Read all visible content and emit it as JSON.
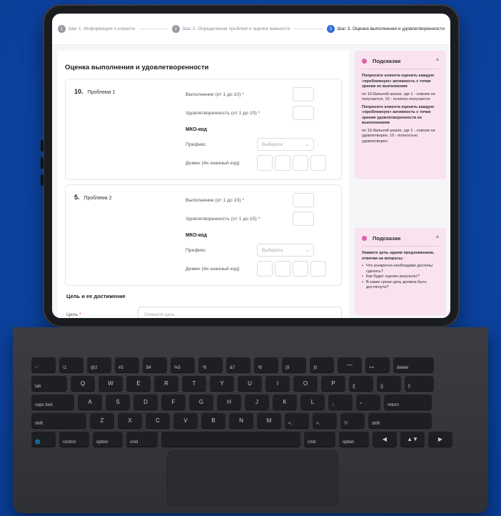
{
  "stepper": {
    "steps": [
      {
        "num": "1",
        "label": "Шаг 1. Информация о клиенте"
      },
      {
        "num": "2",
        "label": "Шаг 2. Определение проблем и оценка важности"
      },
      {
        "num": "3",
        "label": "Шаг 3. Оценка выполнения и удовлетворенности"
      }
    ]
  },
  "main": {
    "title": "Оценка выполнения и удовлетворенности",
    "problems": [
      {
        "num": "10.",
        "name": "Проблема 1",
        "perf_label": "Выполнение (от 1 до 10)",
        "sat_label": "Удовлетворенность (от 1 до 10)",
        "required_mark": "*",
        "mko_label": "МКО-код",
        "prefix_label": "Префикс",
        "prefix_placeholder": "Выберите",
        "domain_label": "Домен (4х-значный код)"
      },
      {
        "num": "5.",
        "name": "Проблема 2",
        "perf_label": "Выполнение (от 1 до 10)",
        "sat_label": "Удовлетворенность (от 1 до 10)",
        "required_mark": "*",
        "mko_label": "МКО-код",
        "prefix_label": "Префикс",
        "prefix_placeholder": "Выберите",
        "domain_label": "Домен (4х-значный код)"
      }
    ],
    "goal": {
      "title": "Цель и ее достижение",
      "label": "Цель",
      "required_mark": "*",
      "placeholder": "Опишите цель"
    }
  },
  "hints": [
    {
      "title": "Подсказки",
      "chevron": "^",
      "paragraphs": [
        {
          "bold": true,
          "text": "Попросите клиента оценить каждую «проблемную» активность с точки зрения ее выполнения"
        },
        {
          "bold": false,
          "text": "по 10-бальной шкале, где 1 - совсем не получается, 10 - отлично получается"
        },
        {
          "bold": true,
          "text": "Попросите клиента оценить каждую «проблемную» активность с точки зрения удовлетворенности ее выполнением"
        },
        {
          "bold": false,
          "text": "по 10-бальной шкале, где 1 - совсем не удовлетворен, 10 - полностью удовлетворен"
        }
      ]
    },
    {
      "title": "Подсказки",
      "chevron": "^",
      "intro": "Укажите цель одним предложением, отвечая на вопросы:",
      "items": [
        "Что конкретно необходимо достичь/сделать?",
        "Как будет оценен результат?",
        "В какие сроки цель должна быть достигнута?"
      ]
    }
  ],
  "keyboard": {
    "rows": [
      [
        "~`",
        "!1",
        "@2",
        "#3",
        "$4",
        "%5",
        "^6",
        "&7",
        "*8",
        "(9",
        ")0",
        "—",
        "+=",
        "delete"
      ],
      [
        "tab",
        "Q",
        "W",
        "E",
        "R",
        "T",
        "Y",
        "U",
        "I",
        "O",
        "P",
        "{[",
        "}]",
        "|\\"
      ],
      [
        "caps lock",
        "A",
        "S",
        "D",
        "F",
        "G",
        "H",
        "J",
        "K",
        "L",
        ":;",
        "\"'",
        "return"
      ],
      [
        "shift",
        "Z",
        "X",
        "C",
        "V",
        "B",
        "N",
        "M",
        "<,",
        ">.",
        "?/",
        "shift"
      ],
      [
        "🌐",
        "control",
        "option",
        "cmd",
        "",
        "cmd",
        "option",
        "◀",
        "▲▼",
        "▶"
      ]
    ]
  }
}
